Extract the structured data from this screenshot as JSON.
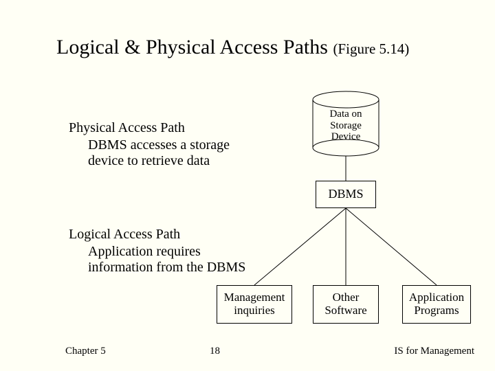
{
  "title": {
    "main": "Logical & Physical Access Paths ",
    "sub": "(Figure 5.14)"
  },
  "physical": {
    "heading": "Physical  Access Path",
    "desc": "DBMS accesses a storage device to retrieve data"
  },
  "logical": {
    "heading": "Logical  Access Path",
    "desc": "Application requires information from the DBMS"
  },
  "diagram": {
    "cylinder": "Data on Storage Device",
    "dbms": "DBMS",
    "bottom": {
      "mgmt": "Management inquiries",
      "other": "Other Software",
      "app": "Application Programs"
    }
  },
  "footer": {
    "left": "Chapter 5",
    "mid": "18",
    "right": "IS for Management"
  }
}
